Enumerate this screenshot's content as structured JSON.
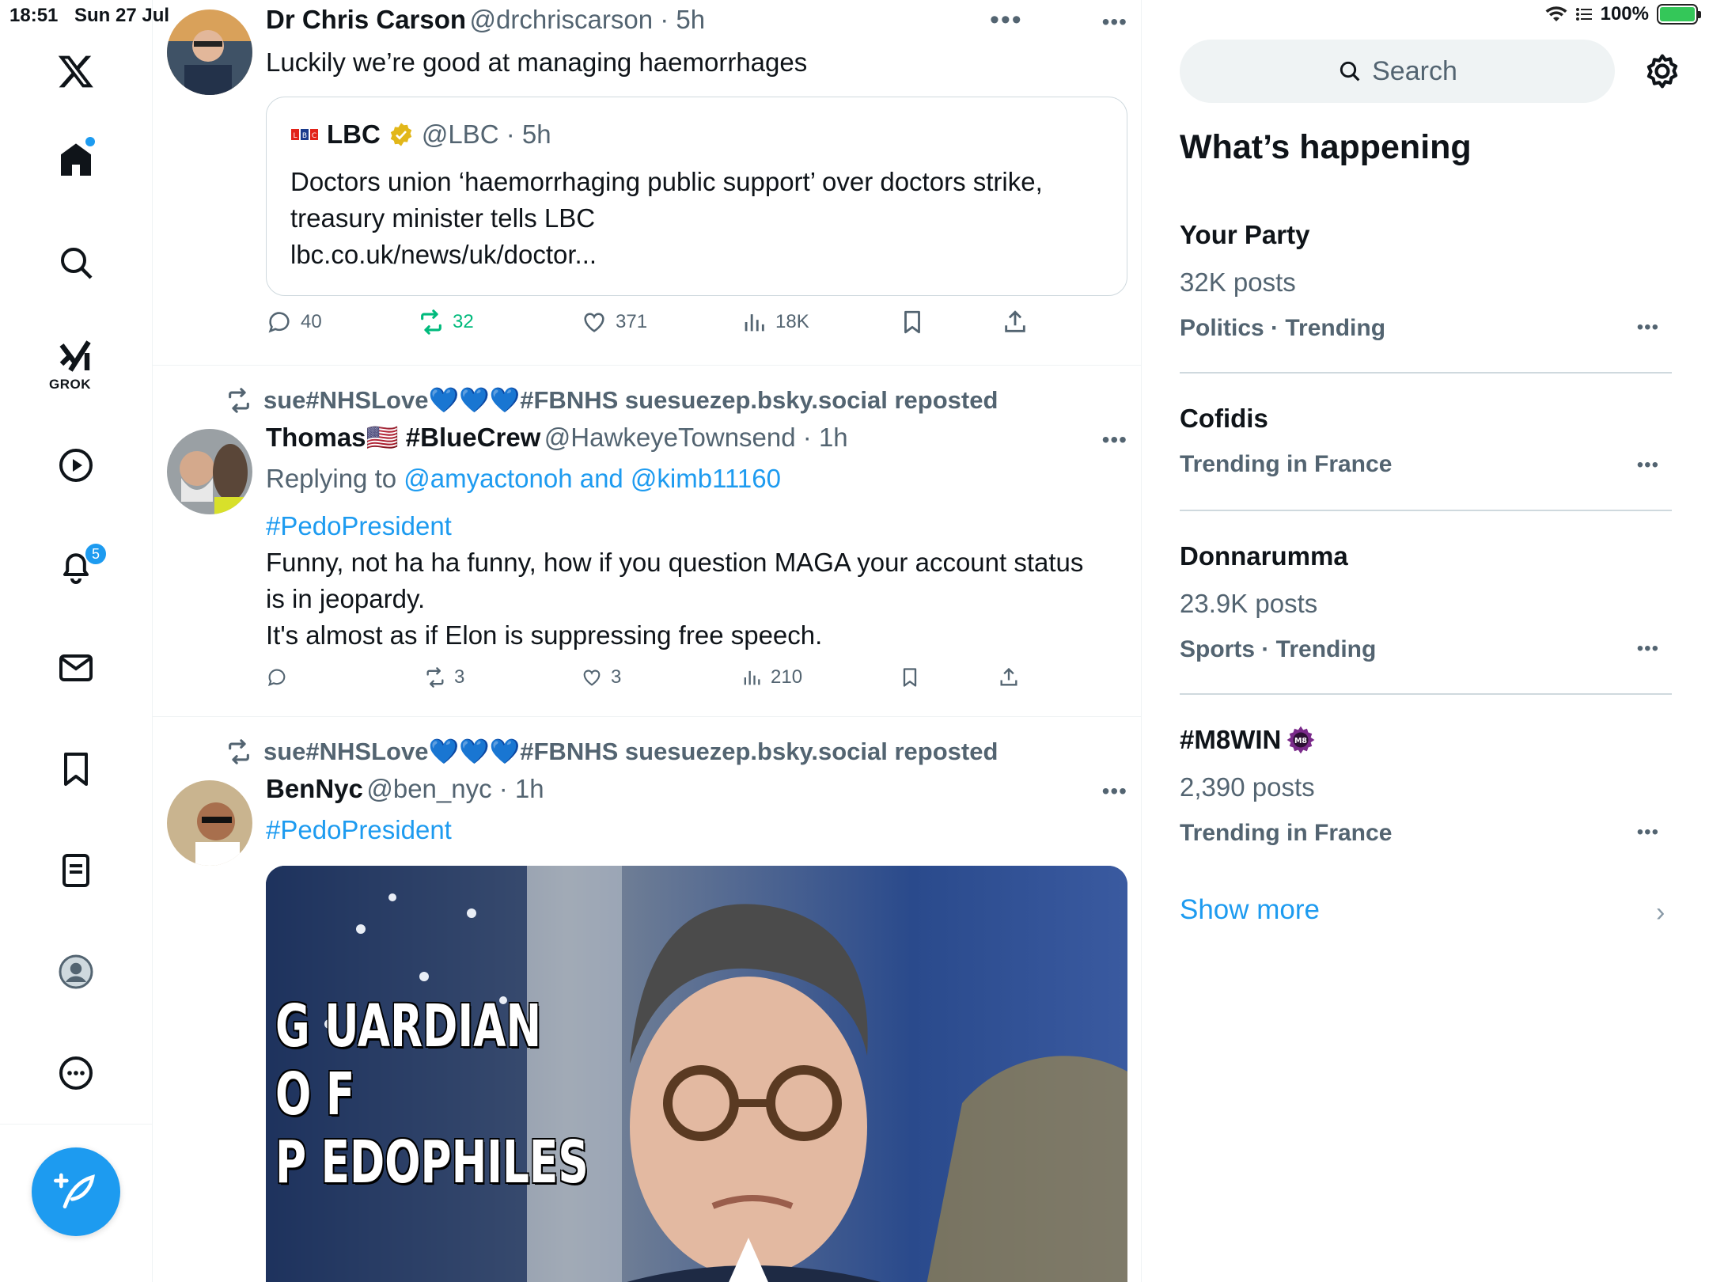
{
  "status": {
    "time": "18:51",
    "date": "Sun 27 Jul",
    "battery": "100%"
  },
  "nav": {
    "grok_label": "GROK",
    "notifications_count": "5"
  },
  "top_dots": "•••",
  "tweets": [
    {
      "name": "Dr Chris Carson",
      "handle": "@drchriscarson · 5h",
      "text": "Luckily we’re good at managing haemorrhages",
      "quote": {
        "name": "LBC",
        "handle": "@LBC · 5h",
        "text": "Doctors union ‘haemorrhaging public support’ over doctors strike, treasury minister tells LBC",
        "link": "lbc.co.uk/news/uk/doctor..."
      },
      "stats": {
        "replies": "40",
        "reposts": "32",
        "likes": "371",
        "views": "18K"
      }
    },
    {
      "repost_line": "sue#NHSLove💙💙💙#FBNHS suesuezep.bsky.social reposted",
      "name": "Thomas🇺🇸 #BlueCrew",
      "handle": "@HawkeyeTownsend · 1h",
      "replying_prefix": "Replying to ",
      "replying_to": "@amyactonoh and @kimb11160",
      "hashtag": "#PedoPresident",
      "text_lines": [
        "Funny, not ha ha funny, how if you question MAGA your account status",
        "is in jeopardy.",
        "It's almost as if Elon is suppressing free speech."
      ],
      "stats": {
        "replies": "",
        "reposts": "3",
        "likes": "3",
        "views": "210"
      }
    },
    {
      "repost_line": "sue#NHSLove💙💙💙#FBNHS suesuezep.bsky.social reposted",
      "name": "BenNyc",
      "handle": "@ben_nyc · 1h",
      "hashtag": "#PedoPresident",
      "image_caption_lines": [
        "G UARDIAN",
        "O F",
        "P EDOPHILES"
      ]
    }
  ],
  "sidebar": {
    "search_placeholder": "Search",
    "title": "What’s happening",
    "trends": [
      {
        "name": "Your Party",
        "posts": "32K posts",
        "category": "Politics · Trending"
      },
      {
        "name": "Cofidis",
        "posts": "",
        "category": "Trending in France"
      },
      {
        "name": "Donnarumma",
        "posts": "23.9K posts",
        "category": "Sports · Trending"
      },
      {
        "name": "#M8WIN",
        "posts": "2,390 posts",
        "category": "Trending in France"
      }
    ],
    "show_more": "Show more",
    "trend_more": "•••"
  },
  "colors": {
    "accent": "#1d9bf0",
    "repost_green": "#00ba7c",
    "muted": "#536471"
  }
}
